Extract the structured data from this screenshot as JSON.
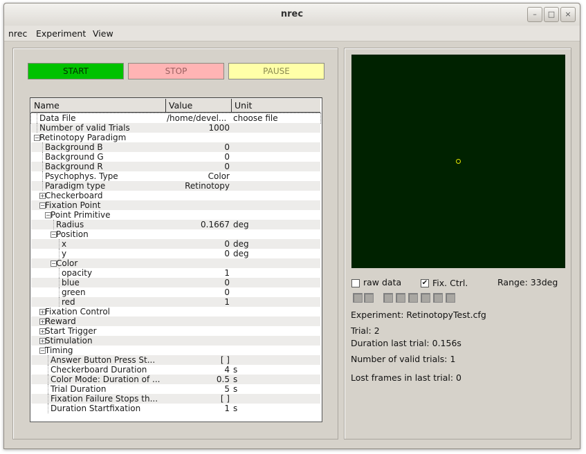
{
  "window": {
    "title": "nrec",
    "buttons": {
      "minimize": "–",
      "maximize": "□",
      "close": "×"
    }
  },
  "menubar": {
    "items": [
      "nrec",
      "Experiment",
      "View"
    ]
  },
  "controls": {
    "start": "START",
    "stop": "STOP",
    "pause": "PAUSE"
  },
  "tree": {
    "headers": {
      "name": "Name",
      "value": "Value",
      "unit": "Unit"
    },
    "rows": [
      {
        "name": "Data File",
        "value": "/home/devel...",
        "unit": "choose file",
        "level": 0,
        "exp": "",
        "vleft": true
      },
      {
        "name": "Number of valid Trials",
        "value": "1000",
        "unit": "",
        "level": 0,
        "exp": ""
      },
      {
        "name": "Retinotopy Paradigm",
        "value": "",
        "unit": "",
        "level": 0,
        "exp": "−"
      },
      {
        "name": "Background B",
        "value": "0",
        "unit": "",
        "level": 1,
        "exp": ""
      },
      {
        "name": "Background G",
        "value": "0",
        "unit": "",
        "level": 1,
        "exp": ""
      },
      {
        "name": "Background R",
        "value": "0",
        "unit": "",
        "level": 1,
        "exp": ""
      },
      {
        "name": "Psychophys. Type",
        "value": "Color",
        "unit": "",
        "level": 1,
        "exp": ""
      },
      {
        "name": "Paradigm type",
        "value": "Retinotopy",
        "unit": "",
        "level": 1,
        "exp": ""
      },
      {
        "name": "Checkerboard",
        "value": "",
        "unit": "",
        "level": 1,
        "exp": "+"
      },
      {
        "name": "Fixation Point",
        "value": "",
        "unit": "",
        "level": 1,
        "exp": "−"
      },
      {
        "name": "Point Primitive",
        "value": "",
        "unit": "",
        "level": 2,
        "exp": "−"
      },
      {
        "name": "Radius",
        "value": "0.1667",
        "unit": "deg",
        "level": 3,
        "exp": ""
      },
      {
        "name": "Position",
        "value": "",
        "unit": "",
        "level": 3,
        "exp": "−"
      },
      {
        "name": "x",
        "value": "0",
        "unit": "deg",
        "level": 4,
        "exp": ""
      },
      {
        "name": "y",
        "value": "0",
        "unit": "deg",
        "level": 4,
        "exp": ""
      },
      {
        "name": "Color",
        "value": "",
        "unit": "",
        "level": 3,
        "exp": "−"
      },
      {
        "name": "opacity",
        "value": "1",
        "unit": "",
        "level": 4,
        "exp": ""
      },
      {
        "name": "blue",
        "value": "0",
        "unit": "",
        "level": 4,
        "exp": ""
      },
      {
        "name": "green",
        "value": "0",
        "unit": "",
        "level": 4,
        "exp": ""
      },
      {
        "name": "red",
        "value": "1",
        "unit": "",
        "level": 4,
        "exp": ""
      },
      {
        "name": "Fixation Control",
        "value": "",
        "unit": "",
        "level": 1,
        "exp": "+"
      },
      {
        "name": "Reward",
        "value": "",
        "unit": "",
        "level": 1,
        "exp": "+"
      },
      {
        "name": "Start Trigger",
        "value": "",
        "unit": "",
        "level": 1,
        "exp": "+"
      },
      {
        "name": "Stimulation",
        "value": "",
        "unit": "",
        "level": 1,
        "exp": "+"
      },
      {
        "name": "Timing",
        "value": "",
        "unit": "",
        "level": 1,
        "exp": "−"
      },
      {
        "name": "Answer Button Press St...",
        "value": "[  ]",
        "unit": "",
        "level": 2,
        "exp": ""
      },
      {
        "name": "Checkerboard Duration",
        "value": "4",
        "unit": "s",
        "level": 2,
        "exp": ""
      },
      {
        "name": "Color Mode: Duration of ...",
        "value": "0.5",
        "unit": "s",
        "level": 2,
        "exp": ""
      },
      {
        "name": "Trial Duration",
        "value": "5",
        "unit": "s",
        "level": 2,
        "exp": ""
      },
      {
        "name": "Fixation Failure Stops th...",
        "value": "[  ]",
        "unit": "",
        "level": 2,
        "exp": ""
      },
      {
        "name": "Duration Startfixation",
        "value": "1",
        "unit": "s",
        "level": 2,
        "exp": ""
      }
    ]
  },
  "right": {
    "raw_data_label": "raw data",
    "raw_data_checked": false,
    "fix_ctrl_label": "Fix. Ctrl.",
    "fix_ctrl_checked": true,
    "check_mark": "✔",
    "range": "Range: 33deg",
    "experiment": "Experiment: RetinotopyTest.cfg",
    "trial": "Trial: 2",
    "duration_last": "Duration last trial: 0.156s",
    "valid_trials": "Number of valid trials: 1",
    "lost_frames": "Lost frames in last trial: 0",
    "indicator_count": 8,
    "colors": {
      "display_bg": "#002200",
      "fixation": "#e8e800",
      "start": "#00c200",
      "stop": "#ffb4b4",
      "pause": "#ffffa8"
    }
  }
}
